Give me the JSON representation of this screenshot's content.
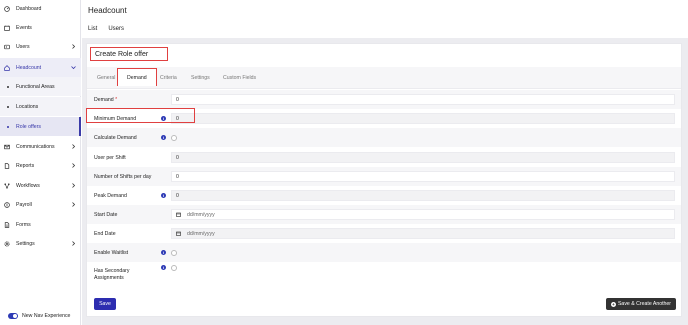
{
  "sidebar": {
    "items": [
      {
        "label": "Dashboard",
        "icon": "dashboard-icon"
      },
      {
        "label": "Events",
        "icon": "calendar-icon"
      },
      {
        "label": "Users",
        "icon": "users-icon"
      },
      {
        "label": "Headcount",
        "icon": "headcount-icon"
      },
      {
        "label": "Communications",
        "icon": "mail-icon"
      },
      {
        "label": "Reports",
        "icon": "document-icon"
      },
      {
        "label": "Workflows",
        "icon": "workflow-icon"
      },
      {
        "label": "Payroll",
        "icon": "payroll-icon"
      },
      {
        "label": "Forms",
        "icon": "form-icon"
      },
      {
        "label": "Settings",
        "icon": "gear-icon"
      }
    ],
    "sub_items": [
      {
        "label": "Functional Areas"
      },
      {
        "label": "Locations"
      },
      {
        "label": "Role offers"
      }
    ],
    "toggle_label": "New Nav Experience",
    "accent": "#2d3ab5"
  },
  "header": {
    "title": "Headcount",
    "tabs": [
      "List",
      "Users"
    ]
  },
  "card": {
    "title": "Create Role offer",
    "tabs": [
      "General",
      "Demand",
      "Criteria",
      "Settings",
      "Custom Fields"
    ],
    "active_tab": "Demand"
  },
  "form": {
    "demand": {
      "label": "Demand",
      "required": "*",
      "value": "0"
    },
    "min_demand": {
      "label": "Minimum Demand",
      "value": "0"
    },
    "calc_demand": {
      "label": "Calculate Demand"
    },
    "user_per_shift": {
      "label": "User per Shift",
      "value": "0"
    },
    "shifts_per_day": {
      "label": "Number of Shifts per day",
      "value": "0"
    },
    "peak_demand": {
      "label": "Peak Demand",
      "value": "0"
    },
    "start_date": {
      "label": "Start Date",
      "placeholder": "dd/mm/yyyy"
    },
    "end_date": {
      "label": "End Date",
      "placeholder": "dd/mm/yyyy"
    },
    "enable_waitlist": {
      "label": "Enable Waitlist"
    },
    "secondary": {
      "label": "Has Secondary Assignments"
    }
  },
  "actions": {
    "save": "Save",
    "save_another": "Save & Create Another"
  }
}
